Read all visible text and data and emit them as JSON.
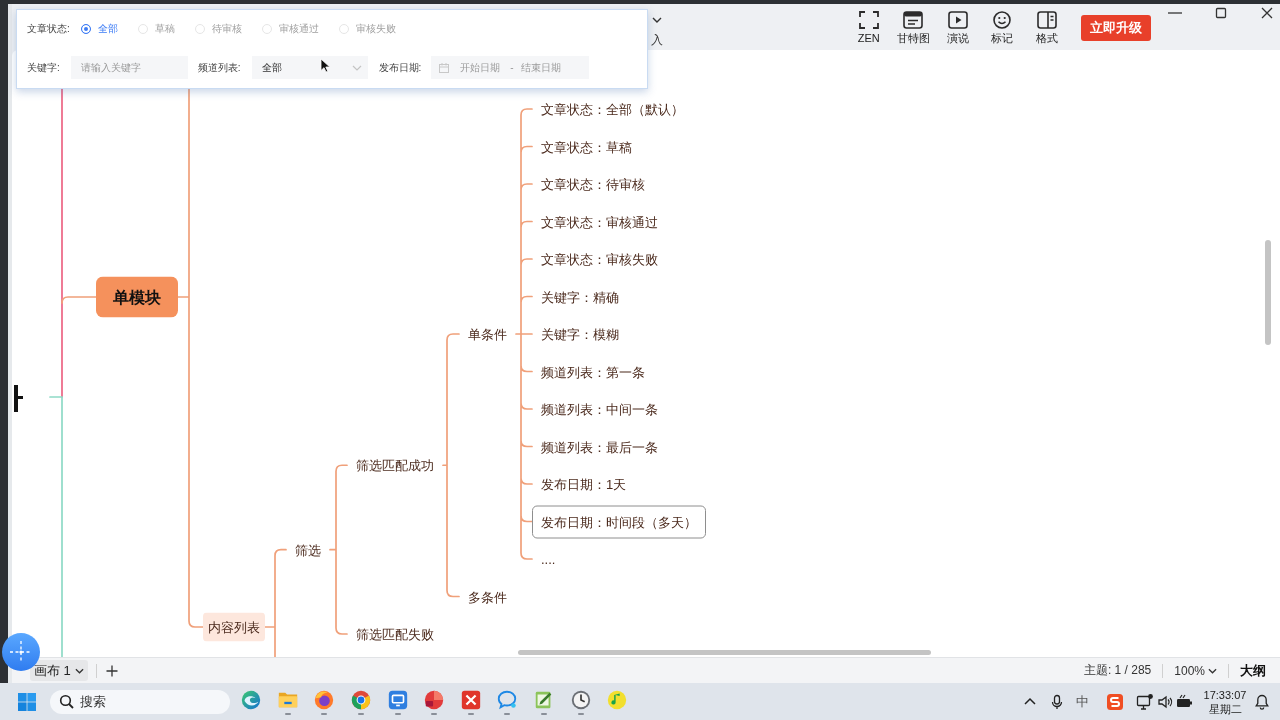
{
  "toolbar": {
    "partial_label": "入",
    "tools": [
      {
        "label": "ZEN",
        "kind": "zen"
      },
      {
        "label": "甘特图",
        "kind": "gantt"
      },
      {
        "label": "演说",
        "kind": "present"
      },
      {
        "label": "标记",
        "kind": "marker"
      },
      {
        "label": "格式",
        "kind": "format"
      }
    ],
    "upgrade_button": "立即升级"
  },
  "filter_panel": {
    "status": {
      "label": "文章状态:",
      "options": [
        {
          "label": "全部",
          "selected": true
        },
        {
          "label": "草稿",
          "selected": false
        },
        {
          "label": "待审核",
          "selected": false
        },
        {
          "label": "审核通过",
          "selected": false
        },
        {
          "label": "审核失败",
          "selected": false
        }
      ]
    },
    "keyword": {
      "label": "关键字:",
      "placeholder": "请输入关键字"
    },
    "channel": {
      "label": "频道列表:",
      "value": "全部"
    },
    "publish_date": {
      "label": "发布日期:",
      "start_placeholder": "开始日期",
      "separator": "-",
      "end_placeholder": "结束日期"
    }
  },
  "mind_map": {
    "topics": [
      {
        "label": "单模块",
        "selected": false,
        "children": [
          {
            "label": "内容列表",
            "selected": false,
            "children": [
              {
                "label": "筛选",
                "selected": false,
                "children": [
                  {
                    "label": "筛选匹配成功",
                    "selected": false,
                    "children": [
                      {
                        "label": "单条件",
                        "selected": false,
                        "children": [
                          {
                            "label": "文章状态：全部（默认）",
                            "selected": false
                          },
                          {
                            "label": "文章状态：草稿",
                            "selected": false
                          },
                          {
                            "label": "文章状态：待审核",
                            "selected": false
                          },
                          {
                            "label": "文章状态：审核通过",
                            "selected": false
                          },
                          {
                            "label": "文章状态：审核失败",
                            "selected": false
                          },
                          {
                            "label": "关键字：精确",
                            "selected": false
                          },
                          {
                            "label": "关键字：模糊",
                            "selected": false
                          },
                          {
                            "label": "频道列表：第一条",
                            "selected": false
                          },
                          {
                            "label": "频道列表：中间一条",
                            "selected": false
                          },
                          {
                            "label": "频道列表：最后一条",
                            "selected": false
                          },
                          {
                            "label": "发布日期：1天",
                            "selected": false
                          },
                          {
                            "label": "发布日期：时间段（多天）",
                            "selected": true
                          },
                          {
                            "label": "....",
                            "selected": false
                          }
                        ]
                      },
                      {
                        "label": "多条件",
                        "selected": false
                      }
                    ]
                  },
                  {
                    "label": "筛选匹配失败",
                    "selected": false
                  }
                ]
              }
            ]
          }
        ]
      }
    ]
  },
  "status_bar": {
    "canvas_tab": "画布 1",
    "topic_count": "主题: 1 / 285",
    "zoom": "100%",
    "outline": "大纲"
  },
  "taskbar": {
    "search_placeholder": "搜索",
    "apps": [
      {
        "kind": "wave",
        "running": false
      },
      {
        "kind": "folder",
        "running": true
      },
      {
        "kind": "flame",
        "running": true
      },
      {
        "kind": "ring",
        "running": true
      },
      {
        "kind": "screen",
        "running": true
      },
      {
        "kind": "reader",
        "running": true
      },
      {
        "kind": "cross",
        "running": true
      },
      {
        "kind": "bubble",
        "running": true
      },
      {
        "kind": "notepad",
        "running": true
      },
      {
        "kind": "clock",
        "running": true
      },
      {
        "kind": "note",
        "running": false
      }
    ],
    "ime": "中",
    "time": "17:33:07",
    "weekday": "星期二"
  }
}
